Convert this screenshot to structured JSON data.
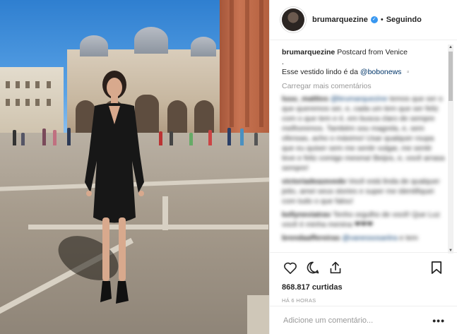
{
  "post": {
    "username": "brumarquezine",
    "follow_status": "Seguindo",
    "separator": "•",
    "verified_mark": "✓"
  },
  "caption": {
    "username": "brumarquezine",
    "line1": "Postcard from Venice",
    "line2": ".",
    "line3_prefix": "Esse vestido lindo é da ",
    "line3_mention": "@bobonews",
    "line3_suffix": " ▫️"
  },
  "load_more_label": "Carregar mais comentários",
  "comments": [
    {
      "user": "luuu_matttos",
      "mention": "@brumarquezine",
      "text": " temos que ser o que queremos ser, e, cada um tem que ser feliz com o que tem e é, em busca claro de sempre melhoremos. Também sou magrela, e, sem ofensas, acho o máximo! Usar qualquer roupa que eu quiser sem me sentir vulgar, me sentir leve e feliz comigo mesma! Beijos, e, você arrasa sempre!"
    },
    {
      "user": "victoriadeazevedo",
      "mention": "",
      "text": " Você está linda de qualquer jeito, amei seus stories e super me identifiquei com tudo o que falou!"
    },
    {
      "user": "kellyneviatrav",
      "mention": "",
      "text": " Tenho orgulho de você! Que Luz você é minha menina ❤❤❤"
    },
    {
      "user": "brendaaffereiras",
      "mention": "@vanessosariira",
      "text": " e tem"
    }
  ],
  "likes": "868.817 curtidas",
  "timestamp": "HÁ 6 HORAS",
  "comment_input": {
    "placeholder": "Adicione um comentário...",
    "more_label": "•••"
  },
  "icons": [
    "heart-icon",
    "comment-icon",
    "share-icon",
    "bookmark-icon",
    "verified-icon",
    "more-options-icon"
  ],
  "colors": {
    "link": "#003569",
    "verified": "#3897f0",
    "muted": "#999999",
    "text": "#262626"
  }
}
